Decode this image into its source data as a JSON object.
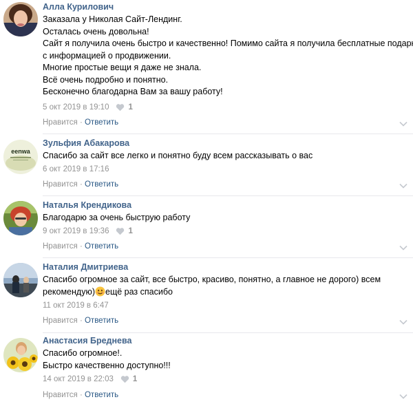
{
  "comments": [
    {
      "author": "Алла Курилович",
      "lines": [
        "Заказала у Николая Сайт-Лендинг.",
        "Осталась очень довольна!",
        "Сайт я получила очень быстро и качественно! Помимо сайта я получила бесплатные подарки",
        "с информацией о продвижении.",
        "Многие простые вещи я даже не знала.",
        "Всё очень подробно и понятно.",
        "Бесконечно благодарна Вам за вашу работу!"
      ],
      "date": "5 окт 2019 в 19:10",
      "likes": "1",
      "like_label": "Нравится",
      "separator": " · ",
      "reply_label": "Ответить"
    },
    {
      "author": "Зульфия Абакарова",
      "lines": [
        "Спасибо за сайт все легко и понятно буду всем рассказывать о вас"
      ],
      "date": "6 окт 2019 в 17:16",
      "like_label": "Нравится",
      "separator": " · ",
      "reply_label": "Ответить"
    },
    {
      "author": "Наталья Крендикова",
      "lines": [
        "Благодарю за очень быструю работу"
      ],
      "date": "9 окт 2019 в 19:36",
      "likes": "1",
      "like_label": "Нравится",
      "separator": " · ",
      "reply_label": "Ответить"
    },
    {
      "author": "Наталия Дмитриева",
      "lines": [
        "Спасибо огромное за сайт, все быстро, красиво, понятно, а главное не дорого) всем",
        "рекомендую)",
        "ещё раз спасибо"
      ],
      "date": "11 окт 2019 в 6:47",
      "like_label": "Нравится",
      "separator": " · ",
      "reply_label": "Ответить"
    },
    {
      "author": "Анастасия Бреднева",
      "lines": [
        "Спасибо огромное!.",
        "Быстро качественно доступно!!!"
      ],
      "date": "14 окт 2019 в 22:03",
      "likes": "1",
      "like_label": "Нравится",
      "separator": " · ",
      "reply_label": "Ответить"
    }
  ],
  "avatar_logo_text": "eenwa",
  "colors": {
    "author": "#42648b",
    "reply_link": "#2a5885",
    "meta": "#939393",
    "divider": "#e7e8ec"
  }
}
